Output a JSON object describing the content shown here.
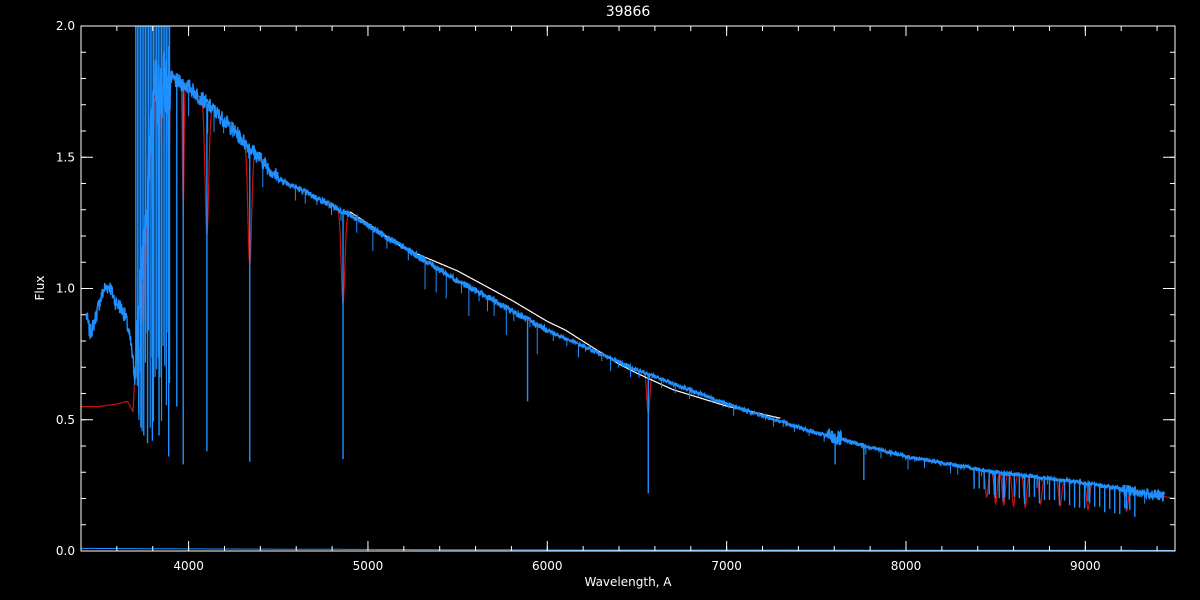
{
  "chart_data": {
    "type": "line",
    "title": "39866",
    "xlabel": "Wavelength, A",
    "ylabel": "Flux",
    "xlim": [
      3400,
      9500
    ],
    "ylim": [
      0.0,
      2.0
    ],
    "x_ticks": [
      4000,
      5000,
      6000,
      7000,
      8000,
      9000
    ],
    "x_tick_labels": [
      "4000",
      "5000",
      "6000",
      "7000",
      "8000",
      "9000"
    ],
    "x_minor_step": 200,
    "y_ticks": [
      0.0,
      0.5,
      1.0,
      1.5,
      2.0
    ],
    "y_tick_labels": [
      "0.0",
      "0.5",
      "1.0",
      "1.5",
      "2.0"
    ],
    "y_minor_step": 0.1,
    "grid": false,
    "colors": {
      "background": "#000000",
      "axes": "#ffffff",
      "observed": "#1e90ff",
      "model": "#cc1111",
      "reference": "#ffffff"
    },
    "continuum": {
      "x": [
        3700,
        3800,
        3900,
        4000,
        4200,
        4500,
        4900,
        5000,
        5500,
        6000,
        6500,
        7000,
        7500,
        8000,
        8500,
        9000,
        9500
      ],
      "y": [
        0.66,
        1.72,
        1.8,
        1.77,
        1.64,
        1.42,
        1.28,
        1.24,
        1.03,
        0.84,
        0.69,
        0.56,
        0.45,
        0.36,
        0.3,
        0.26,
        0.2
      ]
    },
    "blue_prefix": {
      "x": [
        3430,
        3450,
        3470,
        3500,
        3530,
        3560,
        3590,
        3620,
        3650,
        3680,
        3700
      ],
      "y": [
        0.9,
        0.83,
        0.86,
        0.94,
        1.0,
        1.01,
        0.95,
        0.93,
        0.89,
        0.78,
        0.66
      ]
    },
    "red_prefix": {
      "x": [
        3400,
        3500,
        3600,
        3660,
        3690,
        3700
      ],
      "y": [
        0.55,
        0.55,
        0.56,
        0.57,
        0.53,
        0.66
      ]
    },
    "red_lines": {
      "x": [
        3722,
        3734,
        3750,
        3771,
        3798,
        3835,
        3889,
        3970,
        4102,
        4341,
        4861,
        6563,
        8450,
        8500,
        8545,
        8600,
        8665,
        8750,
        8860,
        9015,
        9230
      ],
      "depth": [
        0.25,
        0.3,
        0.35,
        0.4,
        0.45,
        0.5,
        0.5,
        0.5,
        0.5,
        0.45,
        0.35,
        0.15,
        0.1,
        0.12,
        0.12,
        0.12,
        0.12,
        0.1,
        0.1,
        0.1,
        0.08
      ]
    },
    "absorption_lines": {
      "x": [
        3722,
        3734,
        3750,
        3771,
        3798,
        3835,
        3889,
        3934,
        3970,
        4102,
        4341,
        4861,
        5890,
        6563,
        7605,
        7765,
        8498,
        8542,
        8662,
        9015,
        9230
      ],
      "min": [
        0.52,
        0.47,
        0.44,
        0.41,
        0.42,
        0.44,
        0.36,
        0.55,
        0.33,
        0.38,
        0.34,
        0.35,
        0.57,
        0.22,
        0.33,
        0.27,
        0.2,
        0.19,
        0.18,
        0.19,
        0.16
      ]
    },
    "white_excess": {
      "x": [
        4900,
        5200,
        5500,
        5800,
        6100,
        6400,
        6700,
        7000,
        7300
      ],
      "dy": [
        0.0,
        -0.015,
        0.025,
        0.028,
        0.02,
        -0.02,
        -0.035,
        -0.02,
        0.0
      ]
    },
    "error_series": {
      "x": [
        3400,
        4000,
        5000,
        6000,
        7000,
        8000,
        9000,
        9500
      ],
      "y": [
        0.01,
        0.008,
        0.006,
        0.004,
        0.004,
        0.003,
        0.003,
        0.002
      ]
    }
  }
}
